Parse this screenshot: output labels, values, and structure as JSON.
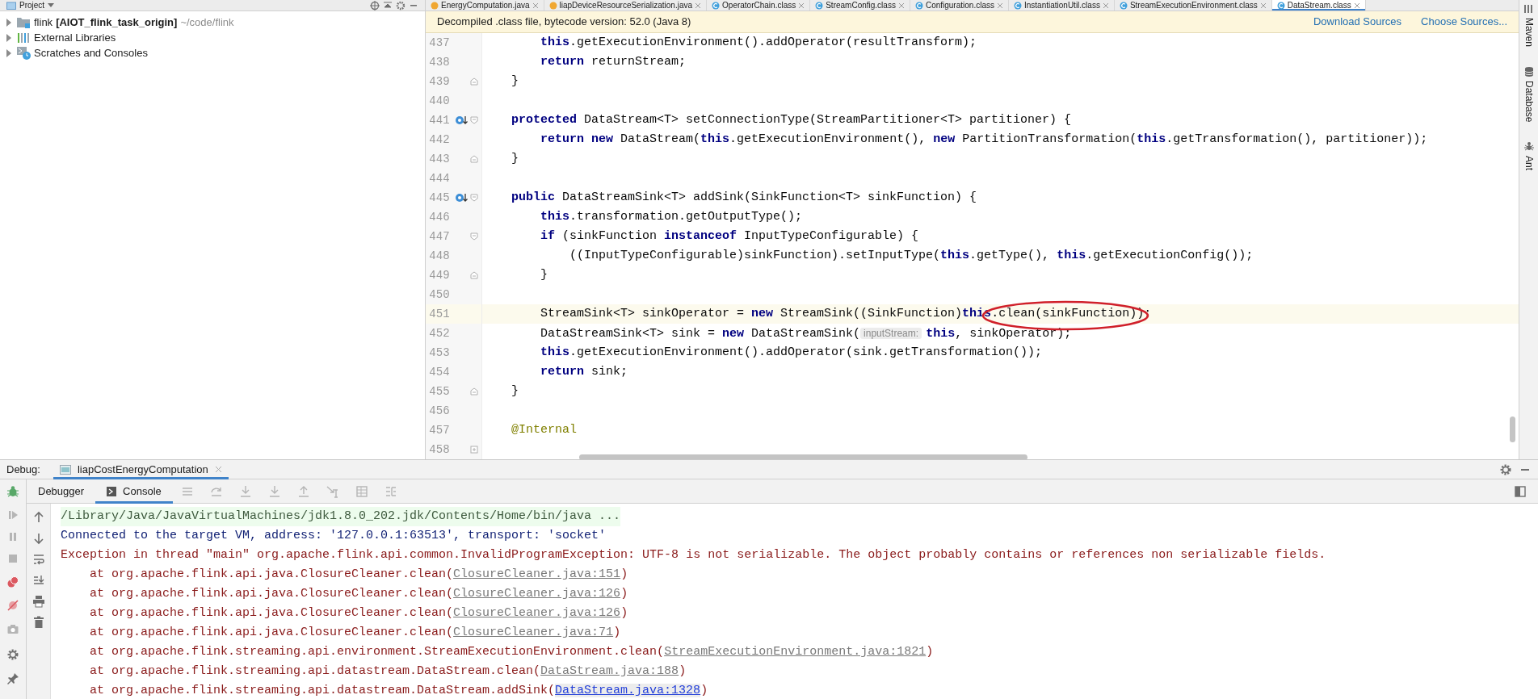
{
  "project_panel": {
    "title": "Project",
    "tree": [
      {
        "kind": "module",
        "name": "flink",
        "module": "[AIOT_flink_task_origin]",
        "path": "~/code/flink",
        "expanded": false
      },
      {
        "kind": "libraries",
        "name": "External Libraries",
        "expanded": false
      },
      {
        "kind": "scratches",
        "name": "Scratches and Consoles",
        "expanded": false
      }
    ]
  },
  "editor_tabs": [
    {
      "label": "EnergyComputation.java",
      "kind": "java",
      "selected": false
    },
    {
      "label": "liapDeviceResourceSerialization.java",
      "kind": "java",
      "selected": false
    },
    {
      "label": "OperatorChain.class",
      "kind": "class",
      "selected": false
    },
    {
      "label": "StreamConfig.class",
      "kind": "class",
      "selected": false
    },
    {
      "label": "Configuration.class",
      "kind": "class",
      "selected": false
    },
    {
      "label": "InstantiationUtil.class",
      "kind": "class",
      "selected": false
    },
    {
      "label": "StreamExecutionEnvironment.class",
      "kind": "class",
      "selected": false
    },
    {
      "label": "DataStream.class",
      "kind": "class",
      "selected": true
    }
  ],
  "banner": {
    "text": "Decompiled .class file, bytecode version: 52.0 (Java 8)",
    "links": [
      "Download Sources",
      "Choose Sources..."
    ]
  },
  "editor": {
    "lines": [
      {
        "number": "437",
        "kind": "code",
        "code": "        **this**.getExecutionEnvironment().addOperator(resultTransform);",
        "current": false
      },
      {
        "number": "438",
        "kind": "code",
        "code": "        **return** returnStream;",
        "current": false
      },
      {
        "number": "439",
        "kind": "code",
        "code": "    }",
        "fold_end": true,
        "current": false
      },
      {
        "number": "440",
        "kind": "code",
        "current": false
      },
      {
        "number": "441",
        "kind": "code",
        "code": "    **protected** DataStream<T> setConnectionType(StreamPartitioner<T> partitioner) {",
        "override": true,
        "fold_start": true,
        "current": false
      },
      {
        "number": "442",
        "kind": "code",
        "code": "        **return** **new** DataStream(**this**.getExecutionEnvironment(), **new** PartitionTransformation(**this**.getTransformation(), partitioner));",
        "current": false
      },
      {
        "number": "443",
        "kind": "code",
        "code": "    }",
        "fold_end": true,
        "current": false
      },
      {
        "number": "444",
        "kind": "code",
        "current": false
      },
      {
        "number": "445",
        "kind": "code",
        "code": "    **public** DataStreamSink<T> addSink(SinkFunction<T> sinkFunction) {",
        "override": true,
        "fold_start": true,
        "current": false
      },
      {
        "number": "446",
        "kind": "code",
        "code": "        **this**.transformation.getOutputType();",
        "current": false
      },
      {
        "number": "447",
        "kind": "code",
        "code": "        **if** (sinkFunction **instanceof** InputTypeConfigurable) {",
        "fold_start": true,
        "current": false
      },
      {
        "number": "448",
        "kind": "code",
        "code": "            ((InputTypeConfigurable)sinkFunction).setInputType(**this**.getType(), **this**.getExecutionConfig());",
        "current": false
      },
      {
        "number": "449",
        "kind": "code",
        "code": "        }",
        "fold_end": true,
        "current": false
      },
      {
        "number": "450",
        "kind": "code",
        "current": false
      },
      {
        "number": "451",
        "kind": "code",
        "code": "        StreamSink<T> sinkOperator = **new** StreamSink((SinkFunction)**this**.clean(sinkFunction));",
        "current": true
      },
      {
        "number": "452",
        "kind": "code",
        "code": "        DataStreamSink<T> sink = **new** DataStreamSink(",
        "hint": "inputStream:",
        "code_after": "**this**, sinkOperator);",
        "current": false
      },
      {
        "number": "453",
        "kind": "code",
        "code": "        **this**.getExecutionEnvironment().addOperator(sink.getTransformation());",
        "current": false
      },
      {
        "number": "454",
        "kind": "code",
        "code": "        **return** sink;",
        "current": false
      },
      {
        "number": "455",
        "kind": "code",
        "code": "    }",
        "fold_end": true,
        "current": false
      },
      {
        "number": "456",
        "kind": "code",
        "current": false
      },
      {
        "number": "457",
        "kind": "annotation",
        "code": "    @Internal",
        "current": false
      },
      {
        "number": "458",
        "kind": "code",
        "fold_collapsed": true,
        "current": false
      }
    ]
  },
  "right_toolbar": [
    {
      "label": "Maven",
      "kind": "maven"
    },
    {
      "label": "Database",
      "kind": "database"
    },
    {
      "label": "Ant",
      "kind": "ant"
    }
  ],
  "debug": {
    "label": "Debug:",
    "session_tab": "liapCostEnergyComputation",
    "tabs": [
      {
        "label": "Debugger",
        "selected": false
      },
      {
        "label": "Console",
        "selected": true
      }
    ],
    "console": [
      {
        "kind": "command",
        "text": "/Library/Java/JavaVirtualMachines/jdk1.8.0_202.jdk/Contents/Home/bin/java ..."
      },
      {
        "kind": "info",
        "text": "Connected to the target VM, address: '127.0.0.1:63513', transport: 'socket'"
      },
      {
        "kind": "error",
        "text": "Exception in thread \"main\" org.apache.flink.api.common.InvalidProgramException: UTF-8 is not serializable. The object probably contains or references non serializable fields."
      },
      {
        "kind": "trace",
        "text": "at org.apache.flink.api.java.ClosureCleaner.clean(",
        "link": "ClosureCleaner.java:151",
        "end": ")",
        "visited": true
      },
      {
        "kind": "trace",
        "text": "at org.apache.flink.api.java.ClosureCleaner.clean(",
        "link": "ClosureCleaner.java:126",
        "end": ")",
        "visited": true
      },
      {
        "kind": "trace",
        "text": "at org.apache.flink.api.java.ClosureCleaner.clean(",
        "link": "ClosureCleaner.java:126",
        "end": ")",
        "visited": true
      },
      {
        "kind": "trace",
        "text": "at org.apache.flink.api.java.ClosureCleaner.clean(",
        "link": "ClosureCleaner.java:71",
        "end": ")",
        "visited": true
      },
      {
        "kind": "trace",
        "text": "at org.apache.flink.streaming.api.environment.StreamExecutionEnvironment.clean(",
        "link": "StreamExecutionEnvironment.java:1821",
        "end": ")",
        "visited": true
      },
      {
        "kind": "trace",
        "text": "at org.apache.flink.streaming.api.datastream.DataStream.clean(",
        "link": "DataStream.java:188",
        "end": ")",
        "visited": true
      },
      {
        "kind": "trace",
        "text": "at org.apache.flink.streaming.api.datastream.DataStream.addSink(",
        "link": "DataStream.java:1328",
        "end": ")",
        "visited": false
      }
    ]
  }
}
